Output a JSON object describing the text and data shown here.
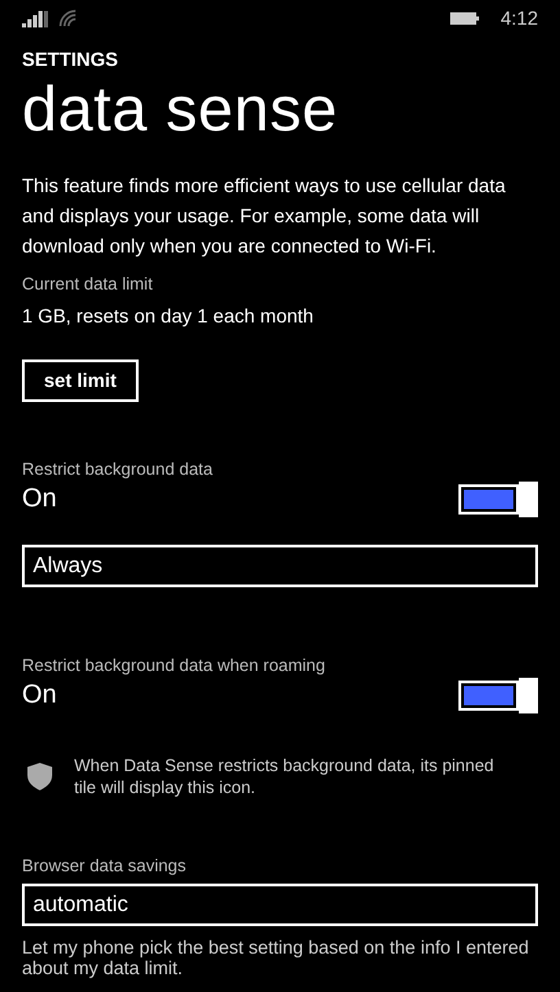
{
  "status_bar": {
    "time": "4:12"
  },
  "header": {
    "app": "SETTINGS",
    "title": "data sense"
  },
  "description": "This feature finds more efficient ways to use cellular data and displays your usage. For example, some data will download only when you are connected to Wi-Fi.",
  "data_limit": {
    "label": "Current data limit",
    "value": "1 GB, resets on day 1 each month",
    "button": "set limit"
  },
  "settings": [
    {
      "kind": "toggle",
      "label": "Restrict background data",
      "state_text": "On",
      "on": true
    },
    {
      "kind": "dropdown",
      "value": "Always"
    },
    {
      "kind": "toggle",
      "label": "Restrict background data when roaming",
      "state_text": "On",
      "on": true
    },
    {
      "kind": "note",
      "text": "When Data Sense restricts background data, its pinned tile will display this icon."
    },
    {
      "kind": "dropdown",
      "label": "Browser data savings",
      "value": "automatic"
    },
    {
      "kind": "text",
      "text": "Let my phone pick the best setting based on the info I entered about my data limit."
    }
  ]
}
